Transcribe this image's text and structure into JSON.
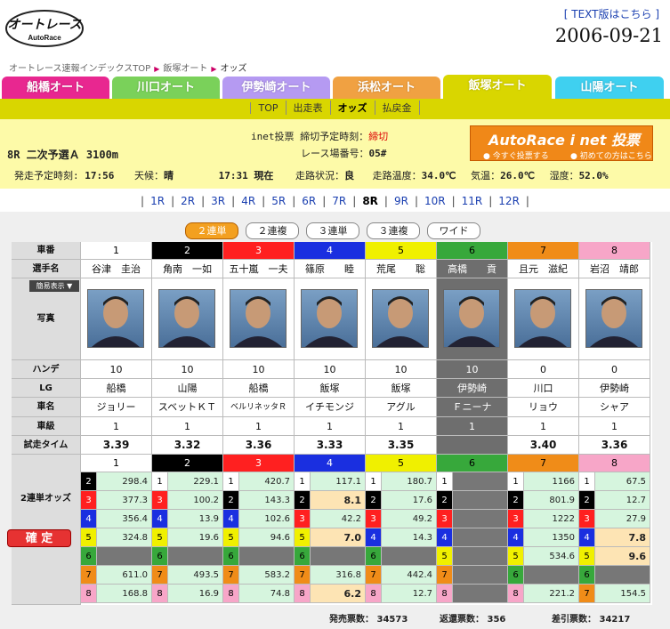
{
  "header": {
    "logo_text": "オートレース",
    "logo_sub": "AutoRace",
    "text_link": "[ TEXT版はこちら ]",
    "date": "2006-09-21"
  },
  "breadcrumb": [
    "オートレース速報インデックスTOP",
    "飯塚オート",
    "オッズ"
  ],
  "tabs": [
    {
      "label": "船橋オート",
      "color": "#e82790"
    },
    {
      "label": "川口オート",
      "color": "#7ad15a"
    },
    {
      "label": "伊勢崎オート",
      "color": "#b59af2"
    },
    {
      "label": "浜松オート",
      "color": "#f0a142"
    },
    {
      "label": "飯塚オート",
      "color": "#ebe86b",
      "active": true
    },
    {
      "label": "山陽オート",
      "color": "#3fd0f0"
    }
  ],
  "subnav": [
    "TOP",
    "出走表",
    "オッズ",
    "払戻金"
  ],
  "subnav_active": 2,
  "race": {
    "title": "8R 二次予選Ａ 3100m",
    "start_label": "発走予定時刻:",
    "start_time": "17:56",
    "weather_label": "天候：",
    "weather": "晴",
    "now": "17:31 現在",
    "track_label": "走路状況：",
    "track": "良",
    "temp_label": "走路温度：",
    "temp": "34.0℃",
    "air_label": "気温：",
    "air": "26.0℃",
    "hum_label": "湿度：",
    "hum": "52.0%",
    "inet_label": "inet投票 締切予定時刻：",
    "inet_status": "締切",
    "venue_label": "レース場番号：",
    "venue": "05#"
  },
  "banner": {
    "title": "AutoRace i net 投票",
    "b1": "今すぐ投票する",
    "b2": "初めての方はこちら"
  },
  "race_nav": [
    "1R",
    "2R",
    "3R",
    "4R",
    "5R",
    "6R",
    "7R",
    "8R",
    "9R",
    "10R",
    "11R",
    "12R"
  ],
  "race_nav_active": 7,
  "bet_buttons": [
    "２連単",
    "２連複",
    "３連単",
    "３連複",
    "ワイド"
  ],
  "bet_active": 0,
  "table": {
    "labels": {
      "car": "車番",
      "name": "選手名",
      "view": "簡易表示",
      "photo": "写真",
      "handicap": "ハンデ",
      "lg": "LG",
      "carname": "車名",
      "class": "車級",
      "trial": "試走タイム",
      "odds": "2連単オッズ",
      "fixed": "確 定"
    },
    "racers": [
      {
        "no": "1",
        "name": "谷津　圭治",
        "handicap": "10",
        "lg": "船橋",
        "car": "ジョリー",
        "class": "1",
        "trial": "3.39",
        "color": "#ffffff",
        "text": "#000"
      },
      {
        "no": "2",
        "name": "角南　一如",
        "handicap": "10",
        "lg": "山陽",
        "car": "スベットＫＴ",
        "class": "1",
        "trial": "3.32",
        "color": "#000000",
        "text": "#fff"
      },
      {
        "no": "3",
        "name": "五十嵐　一夫",
        "handicap": "10",
        "lg": "船橋",
        "car": "ベルリネッタＲ",
        "class": "1",
        "trial": "3.36",
        "color": "#ff2020",
        "text": "#fff"
      },
      {
        "no": "4",
        "name": "篠原　　睦",
        "handicap": "10",
        "lg": "飯塚",
        "car": "イチモンジ",
        "class": "1",
        "trial": "3.33",
        "color": "#1a2fe0",
        "text": "#fff"
      },
      {
        "no": "5",
        "name": "荒尾　　聡",
        "handicap": "10",
        "lg": "飯塚",
        "car": "アグル",
        "class": "1",
        "trial": "3.35",
        "color": "#f0f000",
        "text": "#000"
      },
      {
        "no": "6",
        "name": "高橋　　貢",
        "handicap": "10",
        "lg": "伊勢崎",
        "car": "Ｆニーナ",
        "class": "1",
        "trial": "",
        "color": "#37a83b",
        "text": "#000",
        "scratched": true
      },
      {
        "no": "7",
        "name": "且元　滋紀",
        "handicap": "0",
        "lg": "川口",
        "car": "リョウ",
        "class": "1",
        "trial": "3.40",
        "color": "#f08c18",
        "text": "#000"
      },
      {
        "no": "8",
        "name": "岩沼　靖郎",
        "handicap": "0",
        "lg": "伊勢崎",
        "car": "シャア",
        "class": "1",
        "trial": "3.36",
        "color": "#f7a6c8",
        "text": "#000"
      }
    ],
    "odds": [
      [
        [
          "2",
          "298.4"
        ],
        [
          "3",
          "377.3"
        ],
        [
          "4",
          "356.4"
        ],
        [
          "5",
          "324.8"
        ],
        [
          "6",
          ""
        ],
        [
          "7",
          "611.0"
        ],
        [
          "8",
          "168.8"
        ]
      ],
      [
        [
          "1",
          "229.1"
        ],
        [
          "3",
          "100.2"
        ],
        [
          "4",
          "13.9"
        ],
        [
          "5",
          "19.6"
        ],
        [
          "6",
          ""
        ],
        [
          "7",
          "493.5"
        ],
        [
          "8",
          "16.9"
        ]
      ],
      [
        [
          "1",
          "420.7"
        ],
        [
          "2",
          "143.3"
        ],
        [
          "4",
          "102.6"
        ],
        [
          "5",
          "94.6"
        ],
        [
          "6",
          ""
        ],
        [
          "7",
          "583.2"
        ],
        [
          "8",
          "74.8"
        ]
      ],
      [
        [
          "1",
          "117.1"
        ],
        [
          "2",
          "8.1"
        ],
        [
          "3",
          "42.2"
        ],
        [
          "5",
          "7.0"
        ],
        [
          "6",
          ""
        ],
        [
          "7",
          "316.8"
        ],
        [
          "8",
          "6.2"
        ]
      ],
      [
        [
          "1",
          "180.7"
        ],
        [
          "2",
          "17.6"
        ],
        [
          "3",
          "49.2"
        ],
        [
          "4",
          "14.3"
        ],
        [
          "6",
          ""
        ],
        [
          "7",
          "442.4"
        ],
        [
          "8",
          "12.7"
        ]
      ],
      [
        [
          "1",
          ""
        ],
        [
          "2",
          ""
        ],
        [
          "3",
          ""
        ],
        [
          "4",
          ""
        ],
        [
          "5",
          ""
        ],
        [
          "7",
          ""
        ],
        [
          "8",
          ""
        ]
      ],
      [
        [
          "1",
          "1166"
        ],
        [
          "2",
          "801.9"
        ],
        [
          "3",
          "1222"
        ],
        [
          "4",
          "1350"
        ],
        [
          "5",
          "534.6"
        ],
        [
          "6",
          ""
        ],
        [
          "8",
          "221.2"
        ]
      ],
      [
        [
          "1",
          "67.5"
        ],
        [
          "2",
          "12.7"
        ],
        [
          "3",
          "27.9"
        ],
        [
          "4",
          "7.8"
        ],
        [
          "5",
          "9.6"
        ],
        [
          "6",
          ""
        ],
        [
          "7",
          "154.5"
        ]
      ]
    ]
  },
  "footer": {
    "sold": "発売票数： 34573",
    "returned": "返還票数： 356",
    "net": "差引票数： 34217"
  }
}
